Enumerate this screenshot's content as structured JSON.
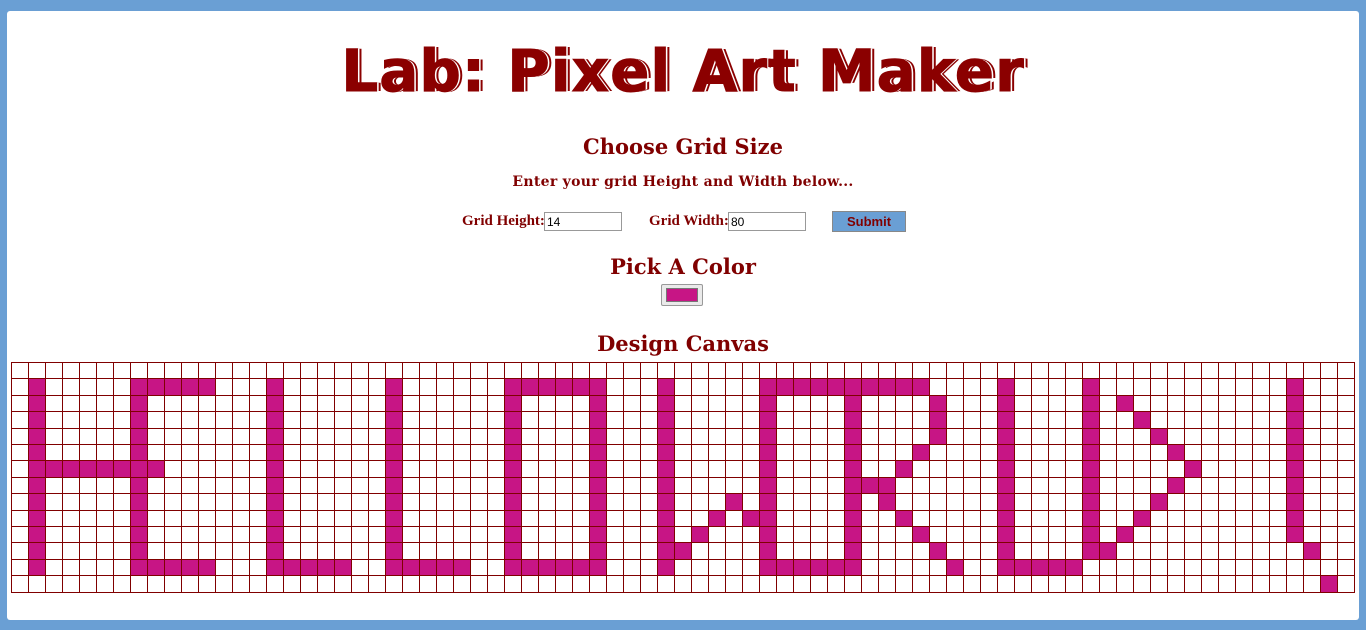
{
  "page": {
    "title": "Lab: Pixel Art Maker",
    "grid_heading": "Choose Grid Size",
    "grid_instructions": "Enter your grid Height and Width below...",
    "color_heading": "Pick A Color",
    "canvas_heading": "Design Canvas"
  },
  "form": {
    "height_label": "Grid Height:",
    "height_value": "14",
    "width_label": "Grid Width:",
    "width_value": "80",
    "submit_label": "Submit"
  },
  "color_picker": {
    "value": "#c71585"
  },
  "colors": {
    "background": "#6a9fd4",
    "accent": "#800000",
    "grid_line": "#800000",
    "paint": "#c71585",
    "cell_empty": "#ffffff"
  },
  "canvas": {
    "rows": 14,
    "cols": 79,
    "pixels": [
      "...............................................................................",
      ".#.....#####...#......#......######...#.....##########....#....#...........#...",
      ".#.....#.......#......#......#....#...#.....#....#....#...#....#.#.........#...",
      ".#.....#.......#......#......#....#...#.....#....#....#...#....#..#........#...",
      ".#.....#.......#......#......#....#...#.....#....#....#...#....#...#.......#...",
      ".#.....#.......#......#......#....#...#.....#....#...#....#....#....#......#...",
      ".########......#......#......#....#...#.....#....#..#.....#....#.....#.....#...",
      ".#.....#.......#......#......#....#...#.....#....###......#....#....#......#...",
      ".#.....#.......#......#......#....#...#...#.#....#.#......#....#...#.......#...",
      ".#.....#.......#......#......#....#...#..#.##....#..#.....#....#..#........#...",
      ".#.....#.......#......#......#....#...#.#...#....#...#....#....#.#.........#...",
      ".#.....#.......#......#......#....#...##....#....#....#...#....##...........#...",
      ".#.....#####...#####..#####..######...#.....######.....#..#####................",
      ".............................................................................#.."
    ]
  }
}
